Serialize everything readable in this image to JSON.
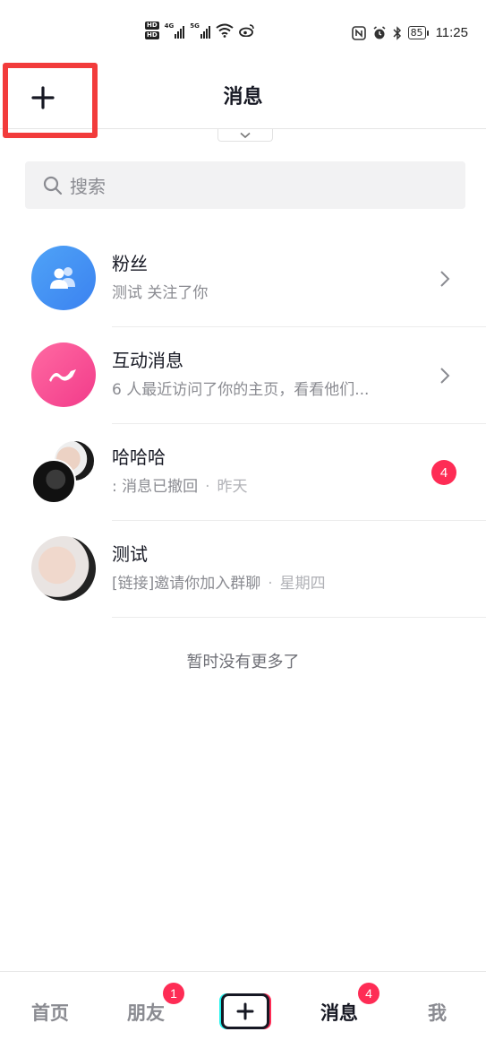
{
  "status_bar": {
    "hd1": "HD",
    "hd2": "HD",
    "net1": "4G",
    "net2": "5G",
    "battery": "85",
    "time": "11:25"
  },
  "header": {
    "title": "消息",
    "add_label": "+"
  },
  "search": {
    "placeholder": "搜索"
  },
  "conversations": [
    {
      "name": "粉丝",
      "subtitle": "测试 关注了你",
      "time": "",
      "icon": "fans-icon"
    },
    {
      "name": "互动消息",
      "subtitle": "6 人最近访问了你的主页，看看他们...",
      "time": "",
      "icon": "interaction-icon"
    },
    {
      "name": "哈哈哈",
      "subtitle": ": 消息已撤回",
      "time": "昨天",
      "unread": "4"
    },
    {
      "name": "测试",
      "subtitle": "[链接]邀请你加入群聊",
      "time": "星期四"
    }
  ],
  "list_footer": "暂时没有更多了",
  "bottom_nav": {
    "home": "首页",
    "friends": "朋友",
    "friends_badge": "1",
    "messages": "消息",
    "messages_badge": "4",
    "me": "我"
  },
  "colors": {
    "accent_red": "#fe2c55",
    "highlight_border": "#f23b3b",
    "cyan": "#25f4ee"
  }
}
